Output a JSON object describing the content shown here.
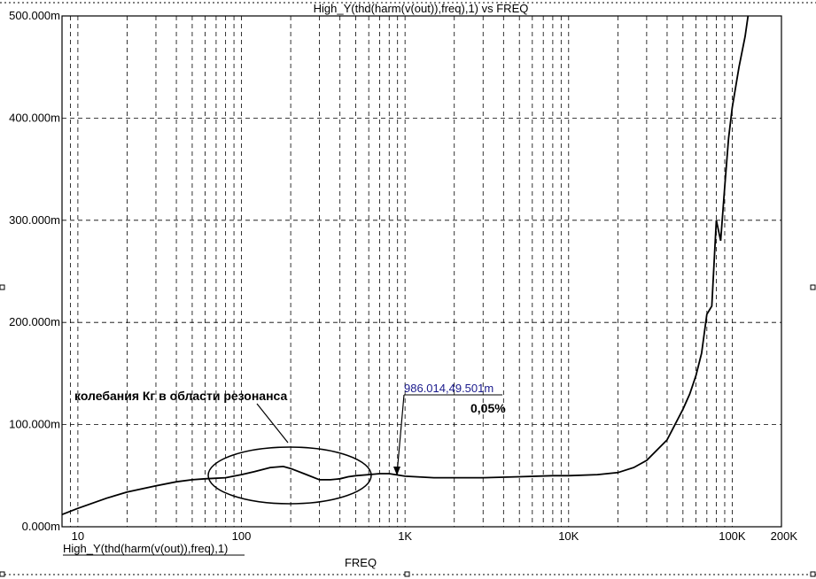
{
  "chart_data": {
    "type": "line",
    "title": "High_Y(thd(harm(v(out)),freq),1) vs FREQ",
    "xlabel": "FREQ",
    "ylabel": "",
    "x_scale": "log",
    "xlim": [
      8,
      200000
    ],
    "ylim": [
      0,
      0.5
    ],
    "x_ticks": [
      {
        "value": 10,
        "label": "10"
      },
      {
        "value": 100,
        "label": "100"
      },
      {
        "value": 1000,
        "label": "1K"
      },
      {
        "value": 10000,
        "label": "10K"
      },
      {
        "value": 100000,
        "label": "100K"
      },
      {
        "value": 200000,
        "label": "200K"
      }
    ],
    "y_ticks": [
      {
        "value": 0.0,
        "label": "0.000m"
      },
      {
        "value": 0.1,
        "label": "100.000m"
      },
      {
        "value": 0.2,
        "label": "200.000m"
      },
      {
        "value": 0.3,
        "label": "300.000m"
      },
      {
        "value": 0.4,
        "label": "400.000m"
      },
      {
        "value": 0.5,
        "label": "500.000m"
      }
    ],
    "grid": true,
    "series": [
      {
        "name": "High_Y(thd(harm(v(out)),freq),1)",
        "x": [
          8,
          10,
          15,
          20,
          30,
          40,
          50,
          60,
          80,
          100,
          120,
          150,
          180,
          200,
          250,
          300,
          350,
          400,
          450,
          500,
          600,
          700,
          800,
          1000,
          1500,
          2000,
          3000,
          5000,
          8000,
          10000,
          15000,
          20000,
          25000,
          30000,
          40000,
          50000,
          55000,
          60000,
          65000,
          70000,
          75000,
          80000,
          85000,
          90000,
          95000,
          100000,
          110000,
          120000,
          125000
        ],
        "y": [
          0.012,
          0.018,
          0.028,
          0.034,
          0.04,
          0.044,
          0.046,
          0.047,
          0.048,
          0.051,
          0.054,
          0.058,
          0.059,
          0.057,
          0.051,
          0.046,
          0.046,
          0.047,
          0.049,
          0.05,
          0.051,
          0.052,
          0.052,
          0.0495,
          0.048,
          0.048,
          0.048,
          0.049,
          0.05,
          0.05,
          0.051,
          0.053,
          0.058,
          0.065,
          0.085,
          0.115,
          0.13,
          0.148,
          0.17,
          0.208,
          0.216,
          0.3,
          0.28,
          0.333,
          0.38,
          0.41,
          0.45,
          0.48,
          0.5
        ]
      }
    ],
    "legend": [
      {
        "label": "High_Y(thd(harm(v(out)),freq),1)",
        "position": "bottom-left"
      }
    ],
    "annotations": [
      {
        "text": "колебания Кг в области резонанса",
        "target_x_range": [
          80,
          800
        ]
      },
      {
        "text": "986.014,49.501m",
        "x": 986.014,
        "y": 0.049501
      },
      {
        "text": "0,05%"
      }
    ]
  }
}
